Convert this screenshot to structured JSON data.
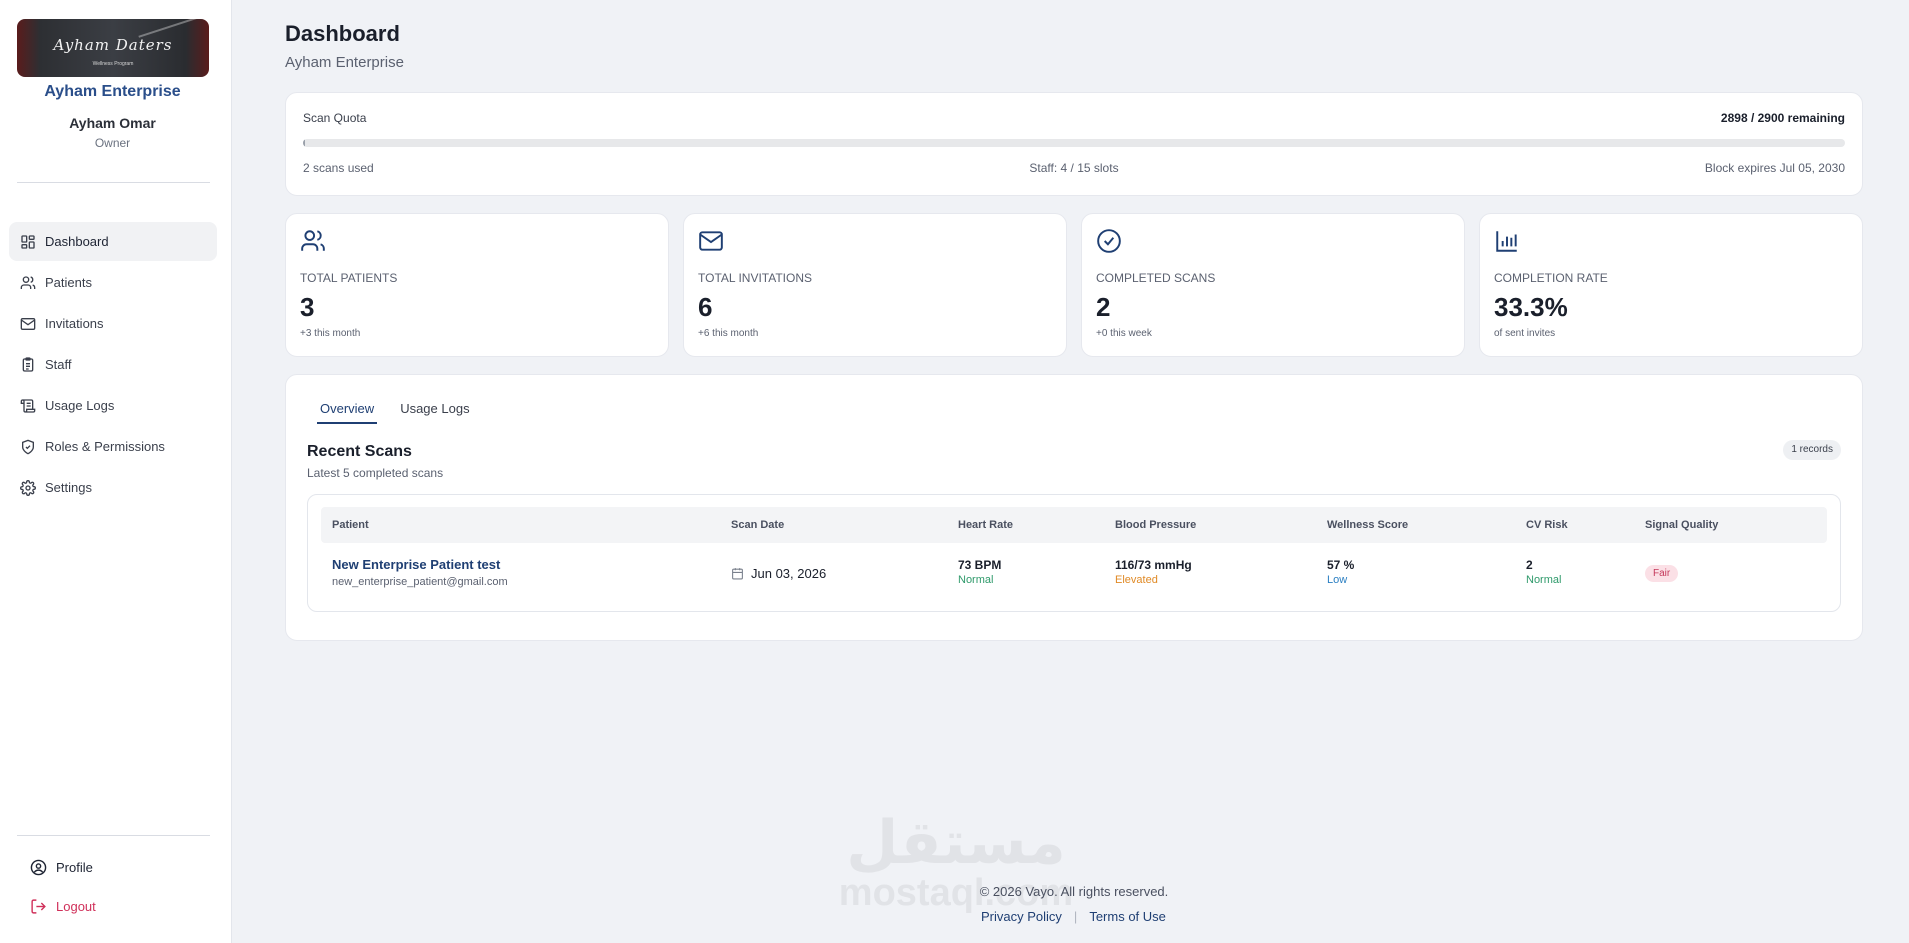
{
  "sidebar": {
    "org_name": "Ayham Enterprise",
    "logo_signature": "Ayham Daters",
    "logo_subtitle": "Wellness Program",
    "user_name": "Ayham Omar",
    "user_role": "Owner",
    "nav": [
      {
        "label": "Dashboard",
        "icon": "dashboard-icon",
        "active": true
      },
      {
        "label": "Patients",
        "icon": "users-icon"
      },
      {
        "label": "Invitations",
        "icon": "mail-icon"
      },
      {
        "label": "Staff",
        "icon": "clipboard-icon"
      },
      {
        "label": "Usage Logs",
        "icon": "scroll-icon"
      },
      {
        "label": "Roles & Permissions",
        "icon": "shield-check-icon"
      },
      {
        "label": "Settings",
        "icon": "gear-icon"
      }
    ],
    "profile_label": "Profile",
    "logout_label": "Logout"
  },
  "header": {
    "title": "Dashboard",
    "subtitle": "Ayham Enterprise"
  },
  "quota": {
    "label": "Scan Quota",
    "remaining": "2898 / 2900 remaining",
    "used_fraction": 0.0007,
    "used": "2 scans used",
    "staff": "Staff: 4 / 15 slots",
    "expires": "Block expires Jul 05, 2030"
  },
  "stats": [
    {
      "label": "TOTAL PATIENTS",
      "value": "3",
      "note": "+3 this month",
      "icon": "users-icon"
    },
    {
      "label": "TOTAL INVITATIONS",
      "value": "6",
      "note": "+6 this month",
      "icon": "mail-icon"
    },
    {
      "label": "COMPLETED SCANS",
      "value": "2",
      "note": "+0 this week",
      "icon": "check-circle-icon"
    },
    {
      "label": "COMPLETION RATE",
      "value": "33.3%",
      "note": "of sent invites",
      "icon": "bar-chart-icon"
    }
  ],
  "tabs": [
    {
      "label": "Overview",
      "active": true
    },
    {
      "label": "Usage Logs"
    }
  ],
  "recent_scans": {
    "title": "Recent Scans",
    "subtitle": "Latest 5 completed scans",
    "records": "1 records",
    "columns": [
      "Patient",
      "Scan Date",
      "Heart Rate",
      "Blood Pressure",
      "Wellness Score",
      "CV Risk",
      "Signal Quality"
    ],
    "rows": [
      {
        "patient_name": "New Enterprise Patient test",
        "patient_email": "new_enterprise_patient@gmail.com",
        "scan_date": "Jun 03, 2026",
        "heart_rate": "73 BPM",
        "heart_rate_status": "Normal",
        "blood_pressure": "116/73 mmHg",
        "blood_pressure_status": "Elevated",
        "wellness_score": "57 %",
        "wellness_status": "Low",
        "cv_risk": "2",
        "cv_risk_status": "Normal",
        "signal_quality": "Fair"
      }
    ]
  },
  "footer": {
    "copyright": "© 2026 Vayo. All rights reserved.",
    "privacy": "Privacy Policy",
    "separator": "|",
    "terms": "Terms of Use",
    "watermark_ar": "مستقل",
    "watermark_latin": "mostaql.com"
  },
  "colors": {
    "brand": "#1f3f73",
    "normal": "#2f9a6b",
    "elevated": "#e08a26",
    "low": "#2b7fc2",
    "fair_bg": "#fbe0e6",
    "logout": "#d0305a"
  }
}
